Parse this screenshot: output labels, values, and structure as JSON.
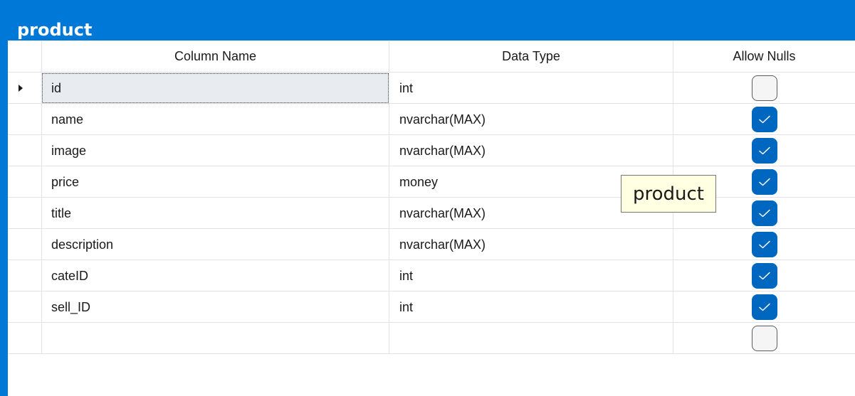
{
  "window": {
    "title": "product",
    "accent_color": "#0078d7"
  },
  "grid": {
    "headers": {
      "column_name": "Column Name",
      "data_type": "Data Type",
      "allow_nulls": "Allow Nulls"
    },
    "rows": [
      {
        "name": "id",
        "type": "int",
        "allow_nulls": false,
        "selected": true
      },
      {
        "name": "name",
        "type": "nvarchar(MAX)",
        "allow_nulls": true
      },
      {
        "name": "image",
        "type": "nvarchar(MAX)",
        "allow_nulls": true
      },
      {
        "name": "price",
        "type": "money",
        "allow_nulls": true
      },
      {
        "name": "title",
        "type": "nvarchar(MAX)",
        "allow_nulls": true
      },
      {
        "name": "description",
        "type": "nvarchar(MAX)",
        "allow_nulls": true
      },
      {
        "name": "cateID",
        "type": "int",
        "allow_nulls": true
      },
      {
        "name": "sell_ID",
        "type": "int",
        "allow_nulls": true
      },
      {
        "name": "",
        "type": "",
        "allow_nulls": false
      }
    ],
    "row_indicator_icon": "current-row-arrow-icon",
    "checked_color": "#0067c0"
  },
  "tooltip": {
    "text": "product",
    "background": "#ffffe1"
  }
}
